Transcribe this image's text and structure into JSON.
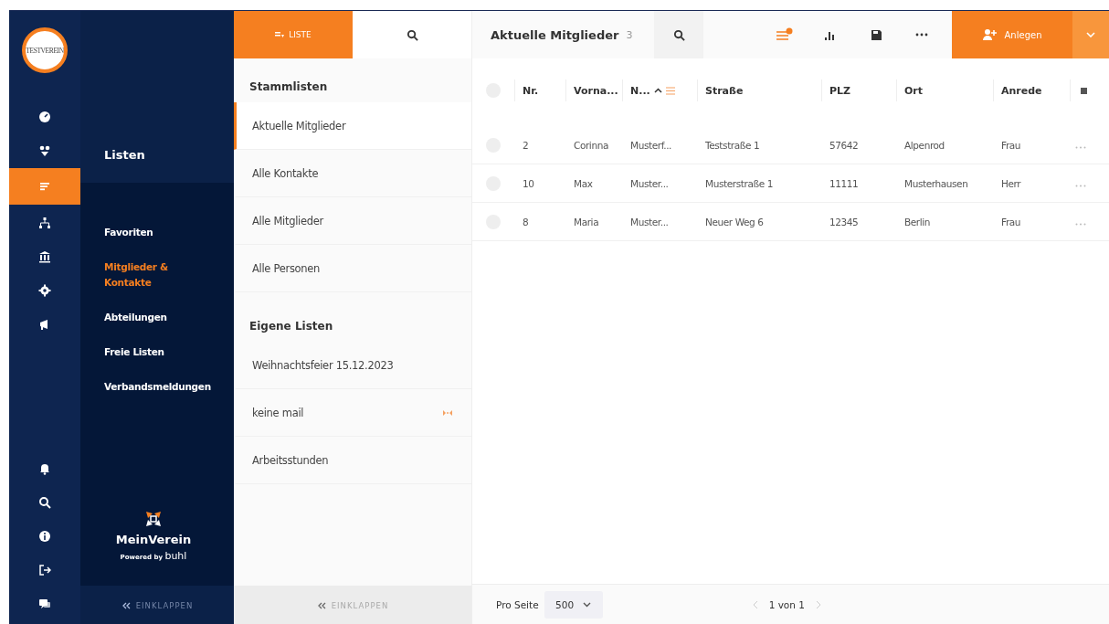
{
  "logo": {
    "text": "TESTVEREIN"
  },
  "rail": {
    "items": [
      {
        "kind": "gauge",
        "selected": false
      },
      {
        "kind": "people",
        "selected": false
      },
      {
        "kind": "list",
        "selected": true
      },
      {
        "kind": "tree",
        "selected": false
      },
      {
        "kind": "bank",
        "selected": false
      },
      {
        "kind": "settings",
        "selected": false
      },
      {
        "kind": "megaphone",
        "selected": false
      }
    ],
    "bottom": [
      {
        "kind": "bell"
      },
      {
        "kind": "search"
      },
      {
        "kind": "info"
      },
      {
        "kind": "logout"
      },
      {
        "kind": "chat"
      }
    ]
  },
  "nav": {
    "title": "Listen",
    "items": [
      {
        "label": "Favoriten",
        "selected": false
      },
      {
        "label": "Mitglieder & Kontakte",
        "selected": true
      },
      {
        "label": "Abteilungen",
        "selected": false
      },
      {
        "label": "Freie Listen",
        "selected": false
      },
      {
        "label": "Verbandsmeldungen",
        "selected": false
      }
    ],
    "brand": "MeinVerein",
    "powered": "Powered by",
    "powered_brand": "buhl",
    "collapse": "EINKLAPPEN"
  },
  "lists": {
    "tabs": [
      {
        "kind": "list",
        "label": "LISTE",
        "selected": true
      },
      {
        "kind": "search",
        "selected": false
      }
    ],
    "groups": [
      {
        "title": "Stammlisten",
        "items": [
          {
            "label": "Aktuelle Mitglieder",
            "selected": true,
            "shared": false
          },
          {
            "label": "Alle Kontakte",
            "selected": false,
            "shared": false
          },
          {
            "label": "Alle Mitglieder",
            "selected": false,
            "shared": false
          },
          {
            "label": "Alle Personen",
            "selected": false,
            "shared": false
          }
        ]
      },
      {
        "title": "Eigene Listen",
        "items": [
          {
            "label": "Weihnachtsfeier 15.12.2023",
            "selected": false,
            "shared": false
          },
          {
            "label": "keine mail",
            "selected": false,
            "shared": true
          },
          {
            "label": "Arbeitsstunden",
            "selected": false,
            "shared": false
          }
        ]
      }
    ],
    "collapse": "EINKLAPPEN"
  },
  "main": {
    "title": "Aktuelle Mitglieder",
    "count": "3",
    "create": "Anlegen",
    "select_all": {
      "checked": false
    },
    "row_checked": [
      false,
      false,
      false
    ],
    "columns": [
      "Nr.",
      "Vorna...",
      "N...",
      "Straße",
      "PLZ",
      "Ort",
      "Anrede"
    ],
    "rows": [
      [
        "2",
        "Corinna",
        "Musterf...",
        "Teststraße 1",
        "57642",
        "Alpenrod",
        "Frau"
      ],
      [
        "10",
        "Max",
        "Muster...",
        "Musterstraße 1",
        "11111",
        "Musterhausen",
        "Herr"
      ],
      [
        "8",
        "Maria",
        "Muster...",
        "Neuer Weg 6",
        "12345",
        "Berlin",
        "Frau"
      ]
    ],
    "per_page_label": "Pro Seite",
    "per_page": "500",
    "page": "1 von 1"
  }
}
